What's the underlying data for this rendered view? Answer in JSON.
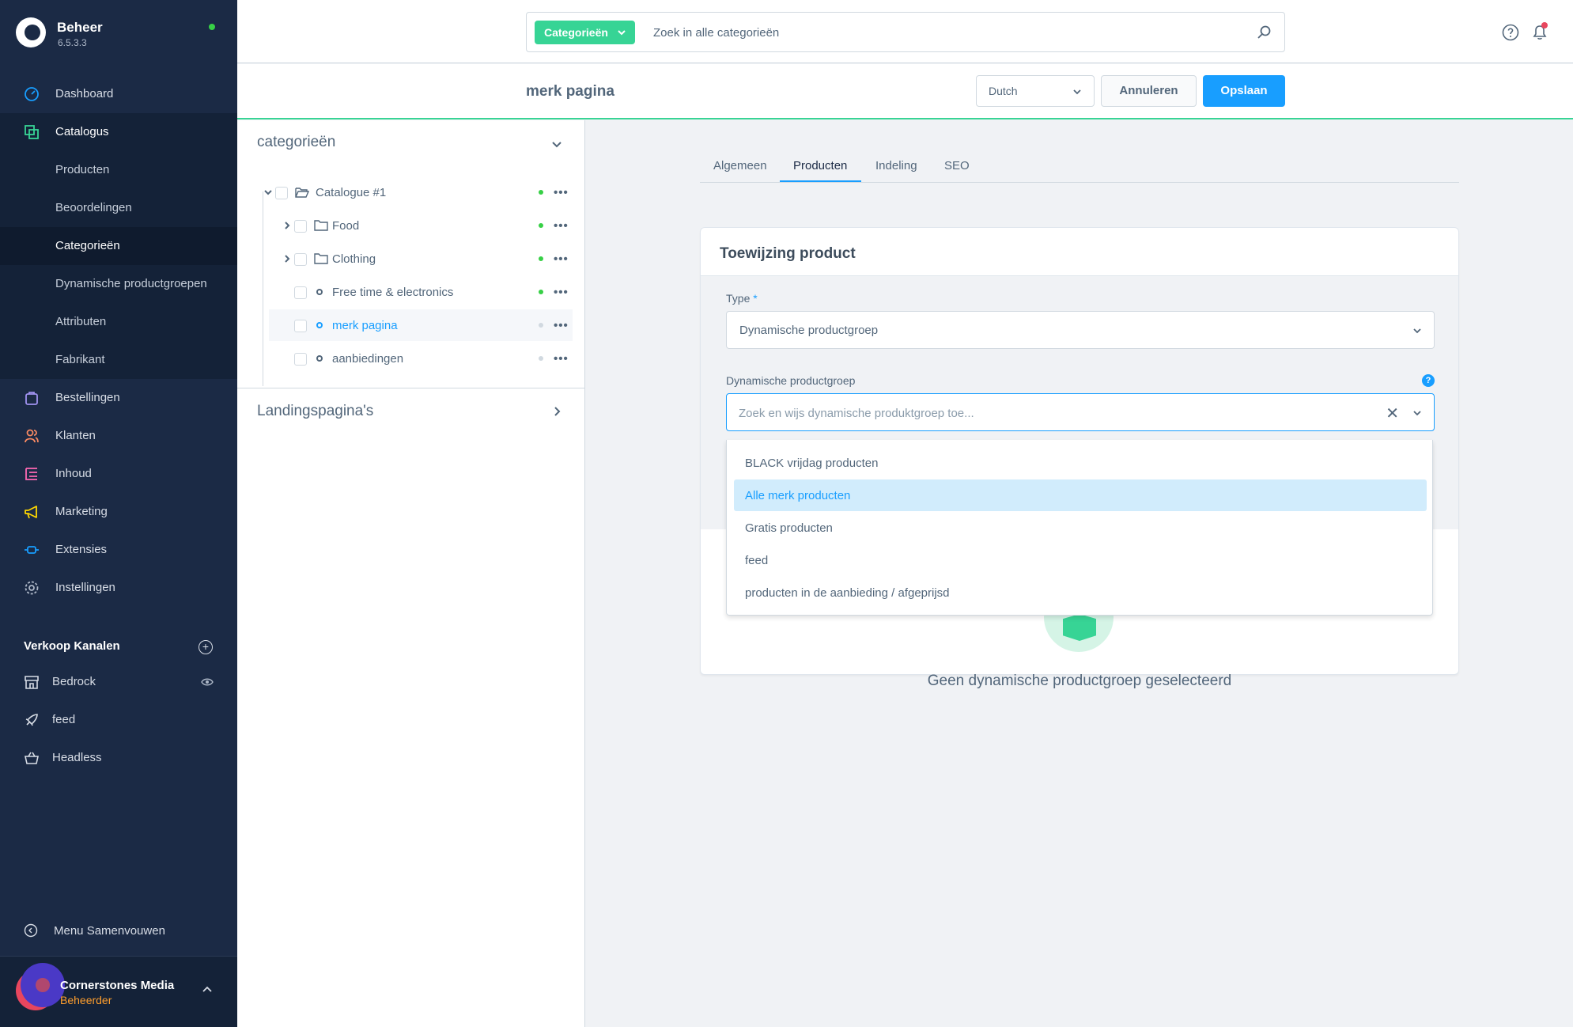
{
  "app": {
    "name": "Beheer",
    "version": "6.5.3.3"
  },
  "sidebar": {
    "items": [
      {
        "label": "Dashboard",
        "icon": "gauge-icon"
      },
      {
        "label": "Catalogus",
        "icon": "catalog-icon"
      },
      {
        "label": "Bestellingen",
        "icon": "bag-icon"
      },
      {
        "label": "Klanten",
        "icon": "users-icon"
      },
      {
        "label": "Inhoud",
        "icon": "content-icon"
      },
      {
        "label": "Marketing",
        "icon": "megaphone-icon"
      },
      {
        "label": "Extensies",
        "icon": "plug-icon"
      },
      {
        "label": "Instellingen",
        "icon": "gear-icon"
      }
    ],
    "catalog_sub": [
      {
        "label": "Producten"
      },
      {
        "label": "Beoordelingen"
      },
      {
        "label": "Categorieën"
      },
      {
        "label": "Dynamische productgroepen"
      },
      {
        "label": "Attributen"
      },
      {
        "label": "Fabrikant"
      }
    ],
    "channels_title": "Verkoop Kanalen",
    "channels": [
      {
        "label": "Bedrock",
        "icon": "storefront-icon"
      },
      {
        "label": "feed",
        "icon": "rocket-icon"
      },
      {
        "label": "Headless",
        "icon": "basket-icon"
      }
    ],
    "collapse_label": "Menu Samenvouwen",
    "user_name": "Cornerstones Media",
    "user_role": "Beheerder",
    "colors": {
      "bg": "#1b2a45",
      "accent": "#189eff",
      "status": "#37d046"
    }
  },
  "topbar": {
    "search_type": "Categorieën",
    "search_placeholder": "Zoek in alle categorieën"
  },
  "smartbar": {
    "title": "merk pagina",
    "language": "Dutch",
    "cancel_label": "Annuleren",
    "save_label": "Opslaan"
  },
  "tree": {
    "title": "categorieën",
    "rows": [
      {
        "label": "Catalogue #1",
        "active": true
      },
      {
        "label": "Food",
        "active": true
      },
      {
        "label": "Clothing",
        "active": true
      },
      {
        "label": "Free time & electronics",
        "active": true
      },
      {
        "label": "merk pagina",
        "active": false
      },
      {
        "label": "aanbiedingen",
        "active": false
      }
    ],
    "more_label": "•••",
    "landing_title": "Landingspagina's"
  },
  "tabs": [
    {
      "label": "Algemeen"
    },
    {
      "label": "Producten"
    },
    {
      "label": "Indeling"
    },
    {
      "label": "SEO"
    }
  ],
  "card": {
    "title": "Toewijzing product",
    "type_label": "Type",
    "required_mark": "*",
    "type_value": "Dynamische productgroep",
    "group_label": "Dynamische productgroep",
    "group_placeholder": "Zoek en wijs dynamische produktgroep toe...",
    "help_mark": "?",
    "clear_mark": "✕",
    "options": [
      {
        "label": "BLACK vrijdag producten"
      },
      {
        "label": "Alle merk producten"
      },
      {
        "label": "Gratis producten"
      },
      {
        "label": "feed"
      },
      {
        "label": "producten in de aanbieding / afgeprijsd"
      }
    ],
    "empty_text": "Geen dynamische productgroep geselecteerd"
  }
}
